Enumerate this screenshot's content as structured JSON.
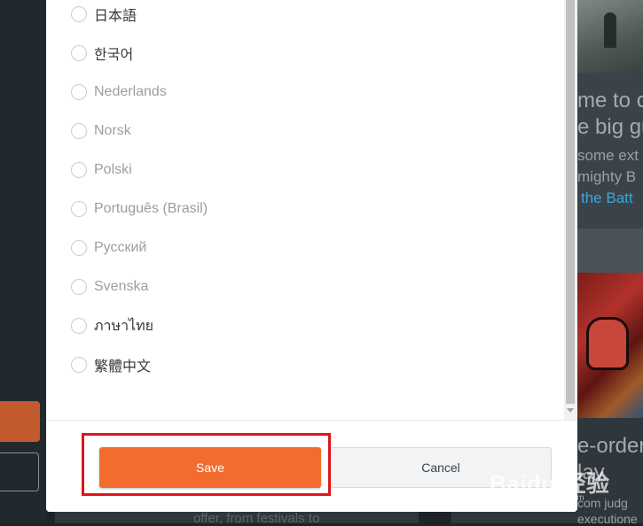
{
  "language_dialog": {
    "options": [
      {
        "label": "日本語",
        "selected": false
      },
      {
        "label": "한국어",
        "selected": false
      },
      {
        "label": "Nederlands",
        "selected": false
      },
      {
        "label": "Norsk",
        "selected": false
      },
      {
        "label": "Polski",
        "selected": false
      },
      {
        "label": "Português (Brasil)",
        "selected": false
      },
      {
        "label": "Русский",
        "selected": false
      },
      {
        "label": "Svenska",
        "selected": false
      },
      {
        "label": "ภาษาไทย",
        "selected": false
      },
      {
        "label": "繁體中文",
        "selected": false
      }
    ],
    "save_label": "Save",
    "cancel_label": "Cancel"
  },
  "background": {
    "article1_title_1": "me to ca",
    "article1_title_2": "e big gu",
    "article1_body_1": "some ext",
    "article1_body_2": "mighty B",
    "article1_link": "the Batt",
    "article2_title_1": "e-order",
    "article2_title_2": "lay",
    "article2_body_1": "com judg",
    "article2_body_2": "executione",
    "bottom_text": "offer, from festivals to"
  },
  "watermark": {
    "main": "Baidu 经验",
    "sub": "jingyan.baidu.com"
  },
  "colors": {
    "accent": "#f26c2f",
    "highlight": "#e0141a",
    "link": "#3aa7d8"
  }
}
